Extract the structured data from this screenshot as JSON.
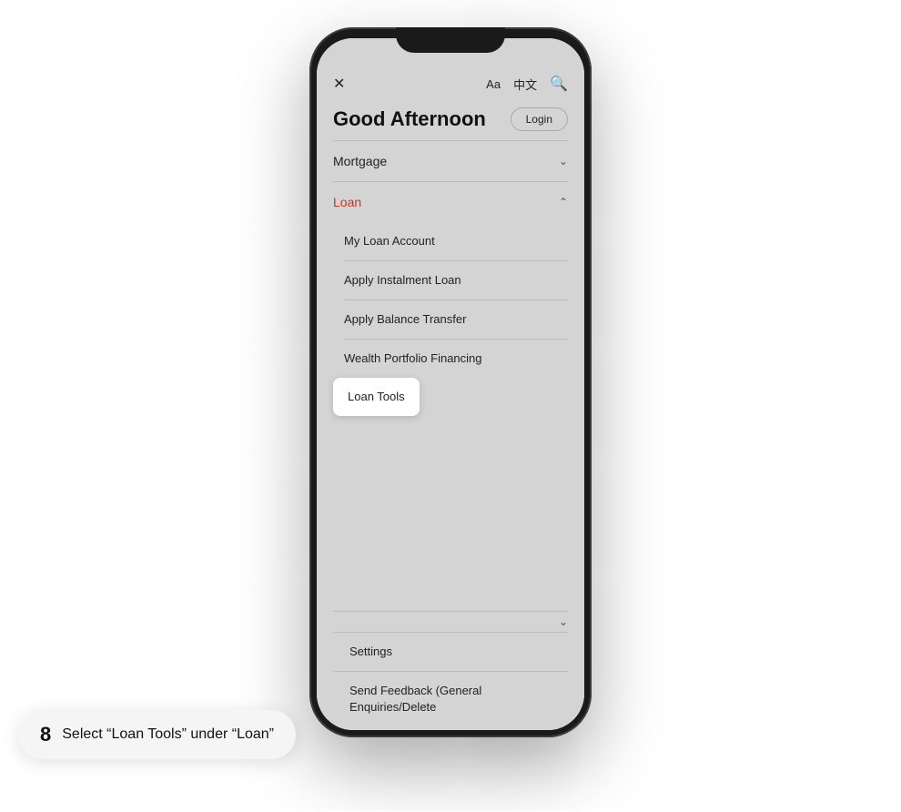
{
  "phone": {
    "topBar": {
      "closeIcon": "✕",
      "fontIcon": "Aa",
      "langIcon": "中文",
      "searchIcon": "🔍"
    },
    "header": {
      "greeting": "Good Afternoon",
      "loginLabel": "Login"
    },
    "menuItems": [
      {
        "id": "mortgage",
        "label": "Mortgage",
        "active": false,
        "expanded": false
      },
      {
        "id": "loan",
        "label": "Loan",
        "active": true,
        "expanded": true
      }
    ],
    "subMenuItems": [
      {
        "id": "my-loan",
        "label": "My Loan Account"
      },
      {
        "id": "apply-instalment",
        "label": "Apply Instalment Loan"
      },
      {
        "id": "apply-balance",
        "label": "Apply Balance Transfer"
      },
      {
        "id": "wealth-portfolio",
        "label": "Wealth Portfolio Financing"
      }
    ],
    "loanTools": {
      "label": "Loan Tools"
    },
    "bottomItems": [
      {
        "id": "settings",
        "label": "Settings"
      },
      {
        "id": "send-feedback",
        "label": "Send Feedback (General Enquiries/Delete"
      }
    ]
  },
  "stepTooltip": {
    "number": "8",
    "text": "Select “Loan Tools” under “Loan”"
  }
}
